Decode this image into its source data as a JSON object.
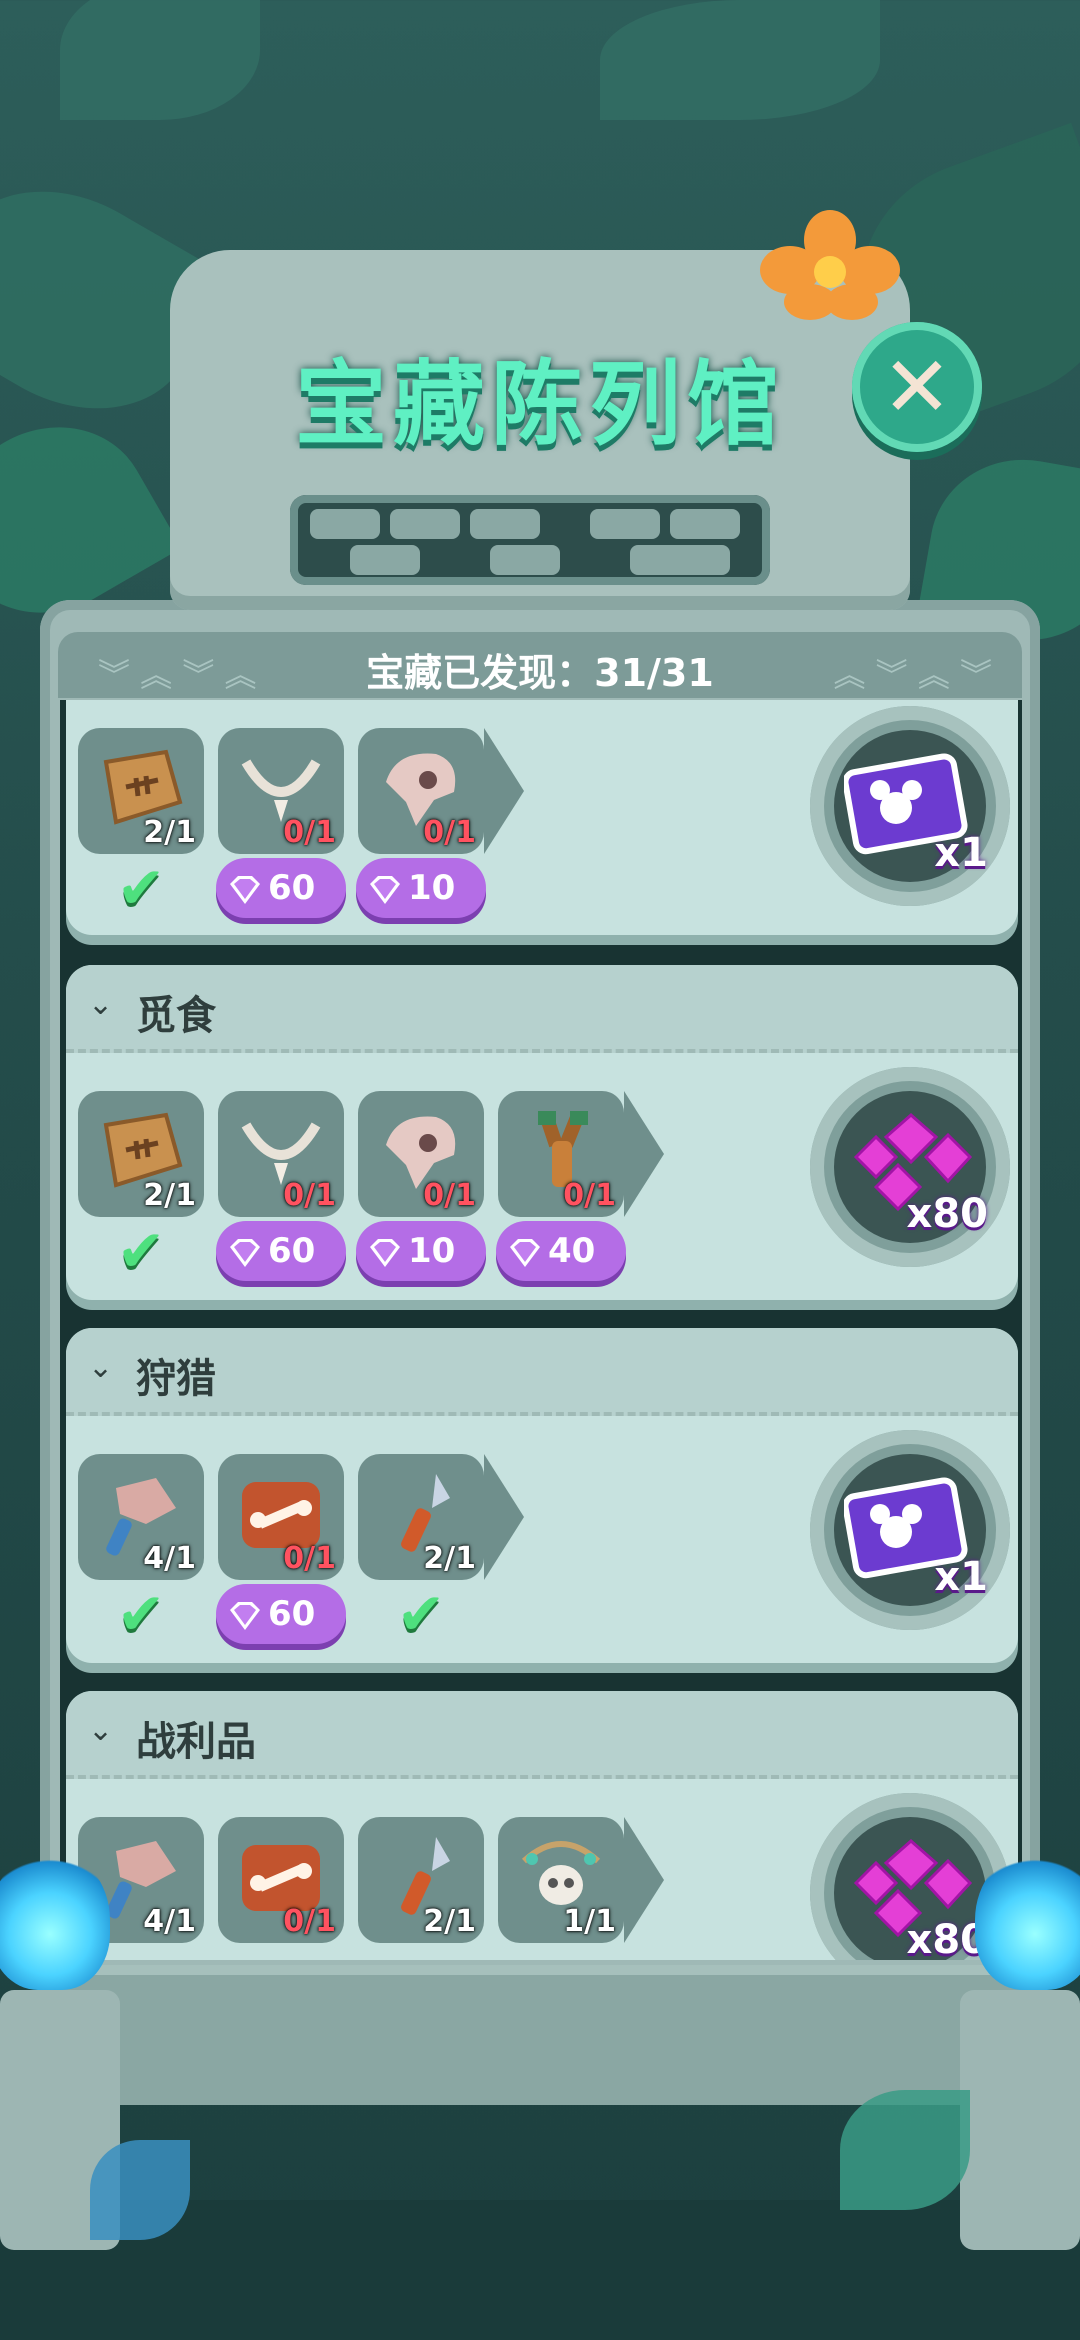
{
  "title": "宝藏陈列馆",
  "summary": "宝藏已发现：31/31",
  "colors": {
    "accent_green": "#5ff0c3",
    "need": "#ff5260",
    "gem": "#b46de6"
  },
  "cards": [
    {
      "name": "",
      "items": [
        {
          "icon": "fossil-fish-icon",
          "count": "2/1",
          "status": "done"
        },
        {
          "icon": "bone-necklace-icon",
          "count": "0/1",
          "status": "gem",
          "cost": "60"
        },
        {
          "icon": "skull-icon",
          "count": "0/1",
          "status": "gem",
          "cost": "10"
        }
      ],
      "reward": {
        "icon": "mickey-card-icon",
        "qty": "x1"
      }
    },
    {
      "name": "觅食",
      "items": [
        {
          "icon": "fossil-fish-icon",
          "count": "2/1",
          "status": "done"
        },
        {
          "icon": "bone-necklace-icon",
          "count": "0/1",
          "status": "gem",
          "cost": "60"
        },
        {
          "icon": "skull-icon",
          "count": "0/1",
          "status": "gem",
          "cost": "10"
        },
        {
          "icon": "slingshot-icon",
          "count": "0/1",
          "status": "gem",
          "cost": "40"
        }
      ],
      "reward": {
        "icon": "gems-pile-icon",
        "qty": "x80"
      }
    },
    {
      "name": "狩猎",
      "items": [
        {
          "icon": "stone-hammer-icon",
          "count": "4/1",
          "status": "done"
        },
        {
          "icon": "bone-plaque-icon",
          "count": "0/1",
          "status": "gem",
          "cost": "60"
        },
        {
          "icon": "spear-icon",
          "count": "2/1",
          "status": "done"
        }
      ],
      "reward": {
        "icon": "mickey-card-icon",
        "qty": "x1"
      }
    },
    {
      "name": "战利品",
      "items": [
        {
          "icon": "stone-hammer-icon",
          "count": "4/1",
          "status": "none"
        },
        {
          "icon": "bone-plaque-icon",
          "count": "0/1",
          "status": "none"
        },
        {
          "icon": "spear-icon",
          "count": "2/1",
          "status": "none"
        },
        {
          "icon": "skull-necklace-icon",
          "count": "1/1",
          "status": "none"
        }
      ],
      "reward": {
        "icon": "gems-pile-icon",
        "qty": "x80"
      }
    }
  ]
}
